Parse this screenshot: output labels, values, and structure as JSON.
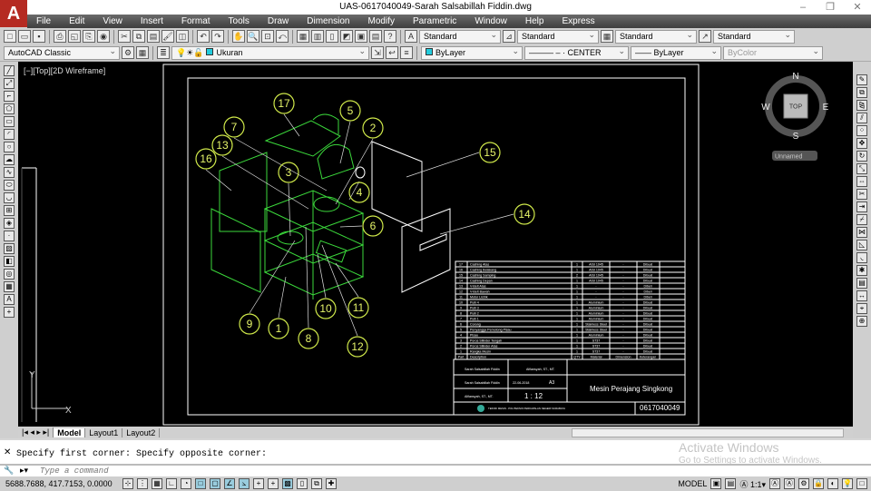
{
  "window": {
    "title": "UAS-0617040049-Sarah Salsabillah Fiddin.dwg",
    "app_logo": "A"
  },
  "menu": [
    "File",
    "Edit",
    "View",
    "Insert",
    "Format",
    "Tools",
    "Draw",
    "Dimension",
    "Modify",
    "Parametric",
    "Window",
    "Help",
    "Express"
  ],
  "styles": {
    "text_style": "Standard",
    "dim_style": "Standard",
    "table_style": "Standard",
    "multileader_style": "Standard"
  },
  "workspace": "AutoCAD Classic",
  "layer": "Ukuran",
  "properties": {
    "color": "ByLayer",
    "linetype": "CENTER",
    "lineweight": "ByLayer",
    "plotstyle": "ByColor"
  },
  "viewport_label": "[−][Top][2D Wireframe]",
  "viewcube": {
    "top": "TOP",
    "n": "N",
    "s": "S",
    "e": "E",
    "w": "W",
    "ucs": "Unnamed"
  },
  "balloons": [
    "17",
    "5",
    "2",
    "7",
    "13",
    "16",
    "3",
    "15",
    "4",
    "6",
    "14",
    "9",
    "1",
    "10",
    "11",
    "8",
    "12"
  ],
  "parts_list": {
    "headers": [
      "Part",
      "Description",
      "QTY",
      "Material",
      "Dimension",
      "Keterangan"
    ],
    "rows": [
      [
        "17",
        "Cashing Atas",
        "1",
        "AISI 1045",
        "-",
        "Dibuat"
      ],
      [
        "16",
        "Cashing Belakang",
        "1",
        "AISI 1045",
        "-",
        "Dibuat"
      ],
      [
        "15",
        "Cashing Samping",
        "2",
        "AISI 1045",
        "-",
        "Dibuat"
      ],
      [
        "14",
        "Cashing Depan",
        "1",
        "AISI 1045",
        "-",
        "Dibuat"
      ],
      [
        "13",
        "V-Belt Atas",
        "1",
        "-",
        "-",
        "Dibeli"
      ],
      [
        "12",
        "V-Belt Bawah",
        "1",
        "-",
        "-",
        "Dibeli"
      ],
      [
        "11",
        "Motor Listrik",
        "1",
        "-",
        "-",
        "Dibeli"
      ],
      [
        "10",
        "Pulli 4",
        "1",
        "Aluminium",
        "-",
        "Dibuat"
      ],
      [
        "9",
        "Pulli 3",
        "1",
        "Aluminium",
        "-",
        "Dibuat"
      ],
      [
        "8",
        "Pulli 2",
        "1",
        "Aluminium",
        "-",
        "Dibuat"
      ],
      [
        "7",
        "Pulli 1",
        "1",
        "Aluminium",
        "-",
        "Dibuat"
      ],
      [
        "6",
        "Corong",
        "1",
        "Stainless Steel",
        "-",
        "Dibuat"
      ],
      [
        "5",
        "Penyangga Pemotong Pisau",
        "1",
        "Stainless Steel",
        "-",
        "Dibuat"
      ],
      [
        "4",
        "Pisau",
        "1",
        "Aluminium",
        "-",
        "Dibuat"
      ],
      [
        "3",
        "Poros Silinder Tengah",
        "1",
        "ST37",
        "-",
        "Dibuat"
      ],
      [
        "2",
        "Poros Silinder Atas",
        "1",
        "ST37",
        "-",
        "Dibuat"
      ],
      [
        "1",
        "Rangka Mesin",
        "1",
        "ST37",
        "-",
        "Dibuat"
      ]
    ]
  },
  "title_block": {
    "designer": "Sarah Salsabillah Fiddin",
    "approved": "Alfiansyah, ST., MT.",
    "drawn": "Sarah Salsabillah Fiddin",
    "date": "22-06-2018",
    "size": "A3",
    "checked": "Alfiansyah, ST., MT.",
    "scale": "1 : 12",
    "title": "Mesin Perajang Singkong",
    "number": "0617040049",
    "institution": "TEKNIK MESIN - POLITEKNIK PERKAPALAN NEGERI SURABAYA"
  },
  "tabs": [
    "Model",
    "Layout1",
    "Layout2"
  ],
  "command": {
    "history": "Specify first corner: Specify opposite corner:",
    "placeholder": "Type a command"
  },
  "status": {
    "coords": "5688.7688, 417.7153, 0.0000",
    "model": "MODEL",
    "annoscale": "1:1"
  },
  "watermark": {
    "title": "Activate Windows",
    "sub": "Go to Settings to activate Windows."
  }
}
